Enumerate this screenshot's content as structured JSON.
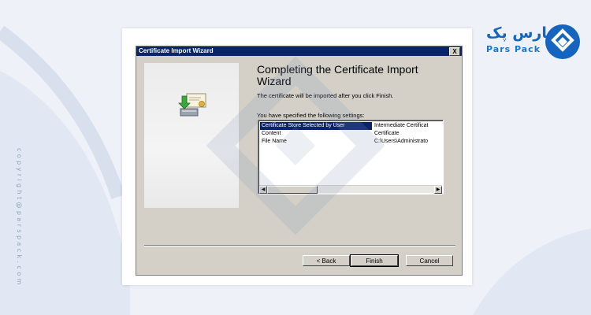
{
  "branding": {
    "logo_fa": "پارس پک",
    "logo_en": "Pars Pack",
    "copyright": "copyright@parspack.com"
  },
  "dialog": {
    "title": "Certificate Import Wizard",
    "close_label": "X",
    "heading": "Completing the Certificate Import Wizard",
    "description": "The certificate will be imported after you click Finish.",
    "settings_label": "You have specified the following settings:",
    "settings": [
      {
        "name": "Certificate Store Selected by User",
        "value": "Intermediate Certificat"
      },
      {
        "name": "Content",
        "value": "Certificate"
      },
      {
        "name": "File Name",
        "value": "C:\\Users\\Administrato"
      }
    ],
    "buttons": {
      "back": "< Back",
      "finish": "Finish",
      "cancel": "Cancel"
    }
  },
  "colors": {
    "titlebar": "#0a246a",
    "dialog_bg": "#d4d0c8",
    "brand_blue": "#1565c0"
  }
}
